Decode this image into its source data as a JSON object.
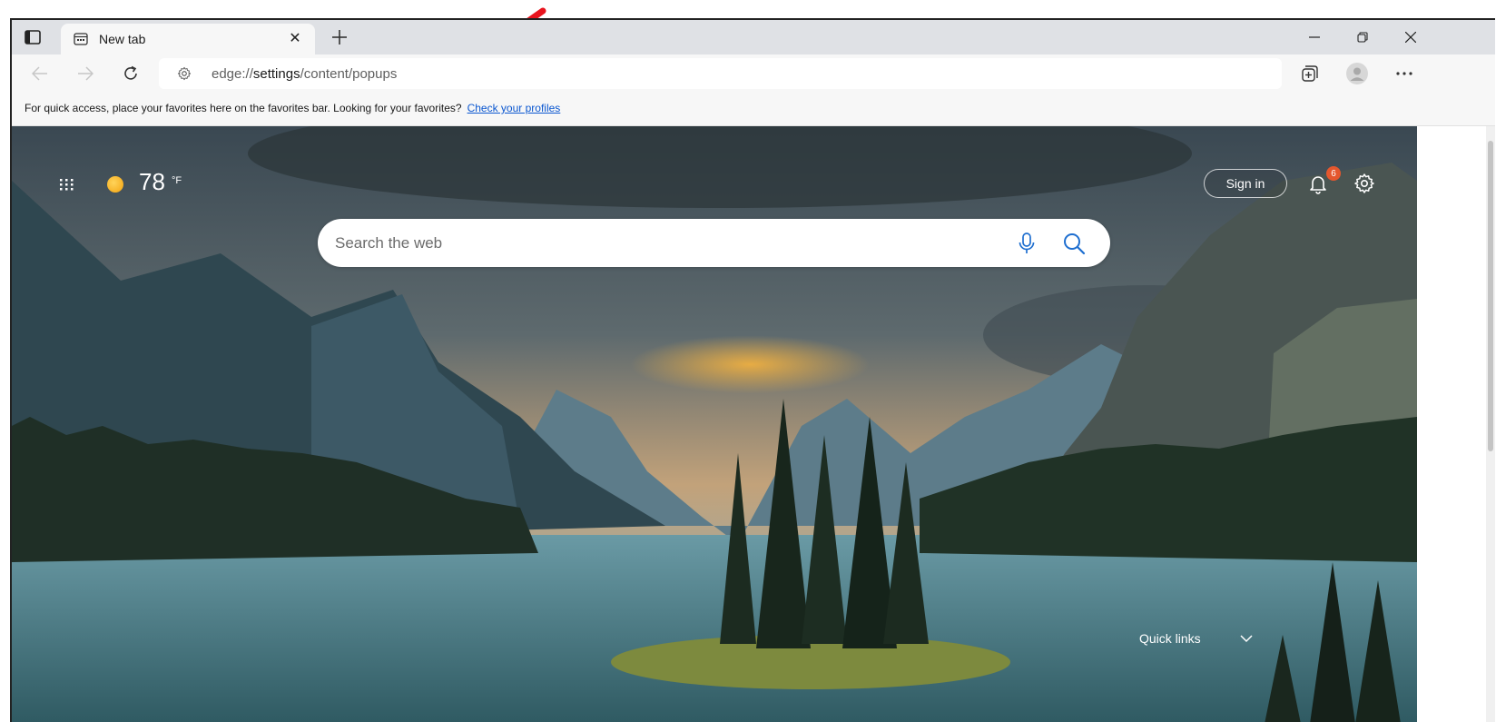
{
  "tab": {
    "title": "New tab"
  },
  "toolbar": {
    "url_prefix": "edge://",
    "url_host": "settings",
    "url_path": "/content/popups"
  },
  "favorites_bar": {
    "message": "For quick access, place your favorites here on the favorites bar. Looking for your favorites?",
    "link": "Check your profiles"
  },
  "newtab_page": {
    "weather": {
      "temperature": "78",
      "unit": "°F"
    },
    "sign_in": "Sign in",
    "notifications_count": "6",
    "search_placeholder": "Search the web",
    "quick_links": "Quick links"
  },
  "icons": {
    "tab_actions": "tab-actions-icon",
    "favicon": "newtab-icon",
    "close": "close-icon",
    "new_tab": "plus-icon",
    "back": "back-arrow-icon",
    "forward": "forward-arrow-icon",
    "refresh": "refresh-icon",
    "settings": "gear-icon",
    "collections": "collections-icon",
    "profile": "profile-icon",
    "more": "more-icon",
    "apps": "apps-grid-icon",
    "mic": "microphone-icon",
    "search": "search-icon",
    "bell": "bell-icon",
    "chevron": "chevron-down-icon"
  },
  "colors": {
    "link": "#0b57d0",
    "badge": "#e4572e",
    "annotation_arrow": "#e8141e"
  }
}
